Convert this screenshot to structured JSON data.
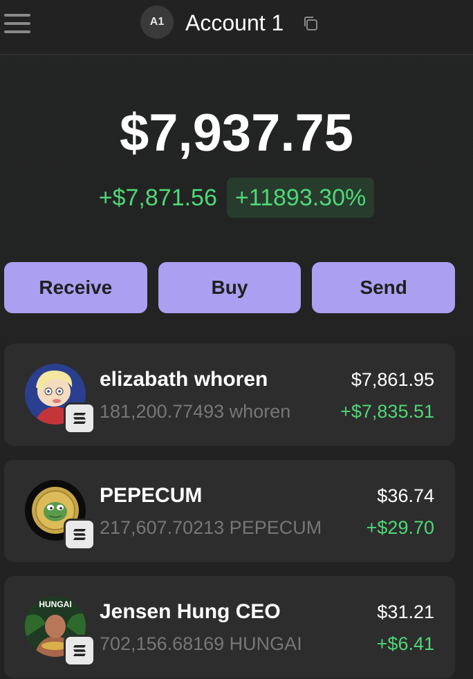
{
  "header": {
    "avatar_initials": "A1",
    "account_name": "Account 1",
    "menu_icon": "hamburger-menu-icon",
    "copy_icon": "copy-icon"
  },
  "balance": {
    "total": "$7,937.75",
    "change_abs": "+$7,871.56",
    "change_pct": "+11893.30%"
  },
  "actions": [
    {
      "label": "Receive"
    },
    {
      "label": "Buy"
    },
    {
      "label": "Send"
    }
  ],
  "tokens": [
    {
      "name": "elizabath whoren",
      "amount": "181,200.77493 whoren",
      "value": "$7,861.95",
      "change": "+$7,835.51",
      "logo": "elizabath-whoren-token-icon"
    },
    {
      "name": "PEPECUM",
      "amount": "217,607.70213 PEPECUM",
      "value": "$36.74",
      "change": "+$29.70",
      "logo": "pepecum-token-icon"
    },
    {
      "name": "Jensen Hung CEO",
      "amount": "702,156.68169 HUNGAI",
      "value": "$31.21",
      "change": "+$6.41",
      "logo": "hungai-token-icon",
      "logo_label": "HUNGAI"
    }
  ],
  "colors": {
    "accent": "#aa9ff0",
    "positive": "#4fd876",
    "background": "#222222",
    "card": "#2d2d2d"
  }
}
